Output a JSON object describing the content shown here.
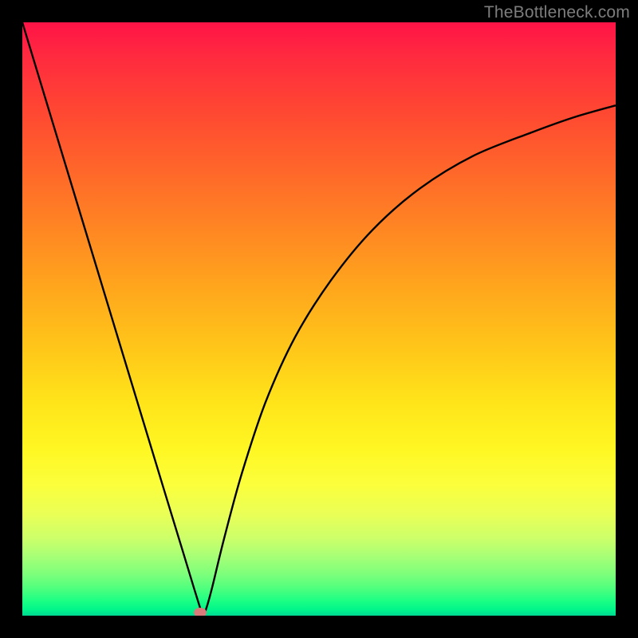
{
  "watermark": "TheBottleneck.com",
  "chart_data": {
    "type": "line",
    "title": "",
    "xlabel": "",
    "ylabel": "",
    "xlim": [
      0,
      1
    ],
    "ylim": [
      0,
      1
    ],
    "series": [
      {
        "name": "curve",
        "x": [
          0.0,
          0.05,
          0.1,
          0.15,
          0.2,
          0.24,
          0.27,
          0.29,
          0.3,
          0.304,
          0.31,
          0.32,
          0.34,
          0.37,
          0.41,
          0.46,
          0.52,
          0.59,
          0.67,
          0.76,
          0.86,
          0.93,
          1.0
        ],
        "y": [
          1.0,
          0.835,
          0.67,
          0.505,
          0.34,
          0.208,
          0.11,
          0.044,
          0.012,
          0.0,
          0.012,
          0.048,
          0.13,
          0.24,
          0.36,
          0.47,
          0.565,
          0.65,
          0.72,
          0.775,
          0.815,
          0.84,
          0.86
        ]
      }
    ],
    "marker": {
      "x": 0.3,
      "y": 0.0
    },
    "gradient_stops": [
      {
        "pos": 0.0,
        "color": "#ff1347"
      },
      {
        "pos": 0.5,
        "color": "#ffbf1a"
      },
      {
        "pos": 0.8,
        "color": "#f5ff40"
      },
      {
        "pos": 1.0,
        "color": "#00d893"
      }
    ]
  }
}
